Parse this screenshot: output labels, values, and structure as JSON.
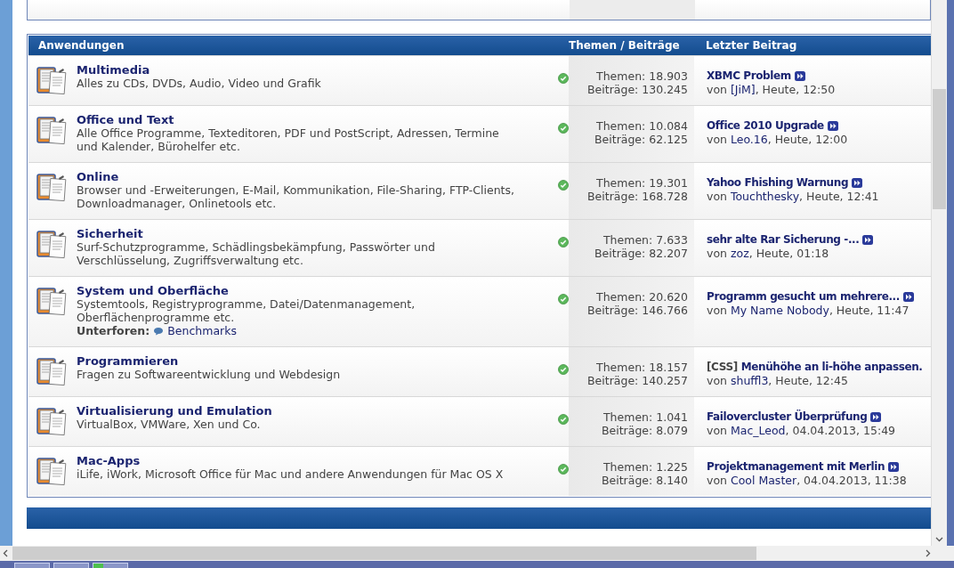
{
  "section": {
    "title": "Anwendungen",
    "col_stats": "Themen / Beiträge",
    "col_last": "Letzter Beitrag"
  },
  "forums": [
    {
      "title": "Multimedia",
      "description": "Alles zu CDs, DVDs, Audio, Video und Grafik",
      "topics": "Themen: 18.903",
      "posts": "Beiträge: 130.245",
      "last": {
        "title": "XBMC Problem",
        "jump": true,
        "by": "von",
        "author": "[JiM]",
        "date": ", Heute, 12:50"
      }
    },
    {
      "title": "Office und Text",
      "description": "Alle Office Programme, Texteditoren, PDF und PostScript, Adressen, Termine und Kalender, Bürohelfer etc.",
      "topics": "Themen: 10.084",
      "posts": "Beiträge: 62.125",
      "last": {
        "title": "Office 2010 Upgrade",
        "jump": true,
        "by": "von",
        "author": "Leo.16",
        "date": ", Heute, 12:00"
      }
    },
    {
      "title": "Online",
      "description": "Browser und -Erweiterungen, E-Mail, Kommunikation, File-Sharing, FTP-Clients, Downloadmanager, Onlinetools etc.",
      "topics": "Themen: 19.301",
      "posts": "Beiträge: 168.728",
      "last": {
        "title": "Yahoo Fhishing Warnung",
        "jump": true,
        "by": "von",
        "author": "Touchthesky",
        "date": ", Heute, 12:41"
      }
    },
    {
      "title": "Sicherheit",
      "description": "Surf-Schutzprogramme, Schädlingsbekämpfung, Passwörter und Verschlüsselung, Zugriffsverwaltung etc.",
      "topics": "Themen: 7.633",
      "posts": "Beiträge: 82.207",
      "last": {
        "title": "sehr alte Rar Sicherung -...",
        "jump": true,
        "by": "von",
        "author": "zoz",
        "date": ", Heute, 01:18"
      }
    },
    {
      "title": "System und Oberfläche",
      "description": "Systemtools, Registryprogramme, Datei/Datenmanagement, Oberflächenprogramme etc.",
      "subforums_label": "Unterforen:",
      "subforums": [
        "Benchmarks"
      ],
      "topics": "Themen: 20.620",
      "posts": "Beiträge: 146.766",
      "last": {
        "title": "Programm gesucht um mehrere...",
        "jump": true,
        "by": "von",
        "author": "My Name Nobody",
        "date": ", Heute, 11:47"
      }
    },
    {
      "title": "Programmieren",
      "description": "Fragen zu Softwareentwicklung und Webdesign",
      "topics": "Themen: 18.157",
      "posts": "Beiträge: 140.257",
      "last": {
        "prefix": "[CSS]",
        "title": "Menühöhe an li-höhe anpassen.",
        "jump": false,
        "by": "von",
        "author": "shuffl3",
        "date": ", Heute, 12:45"
      }
    },
    {
      "title": "Virtualisierung und Emulation",
      "description": "VirtualBox, VMWare, Xen und Co.",
      "topics": "Themen: 1.041",
      "posts": "Beiträge: 8.079",
      "last": {
        "title": "Failovercluster Überprüfung",
        "jump": true,
        "by": "von",
        "author": "Mac_Leod",
        "date": ", 04.04.2013, 15:49"
      }
    },
    {
      "title": "Mac-Apps",
      "description": "iLife, iWork, Microsoft Office für Mac und andere Anwendungen für Mac OS X",
      "topics": "Themen: 1.225",
      "posts": "Beiträge: 8.140",
      "last": {
        "title": "Projektmanagement mit Merlin",
        "jump": true,
        "by": "von",
        "author": "Cool Master",
        "date": ", 04.04.2013, 11:38"
      }
    }
  ]
}
